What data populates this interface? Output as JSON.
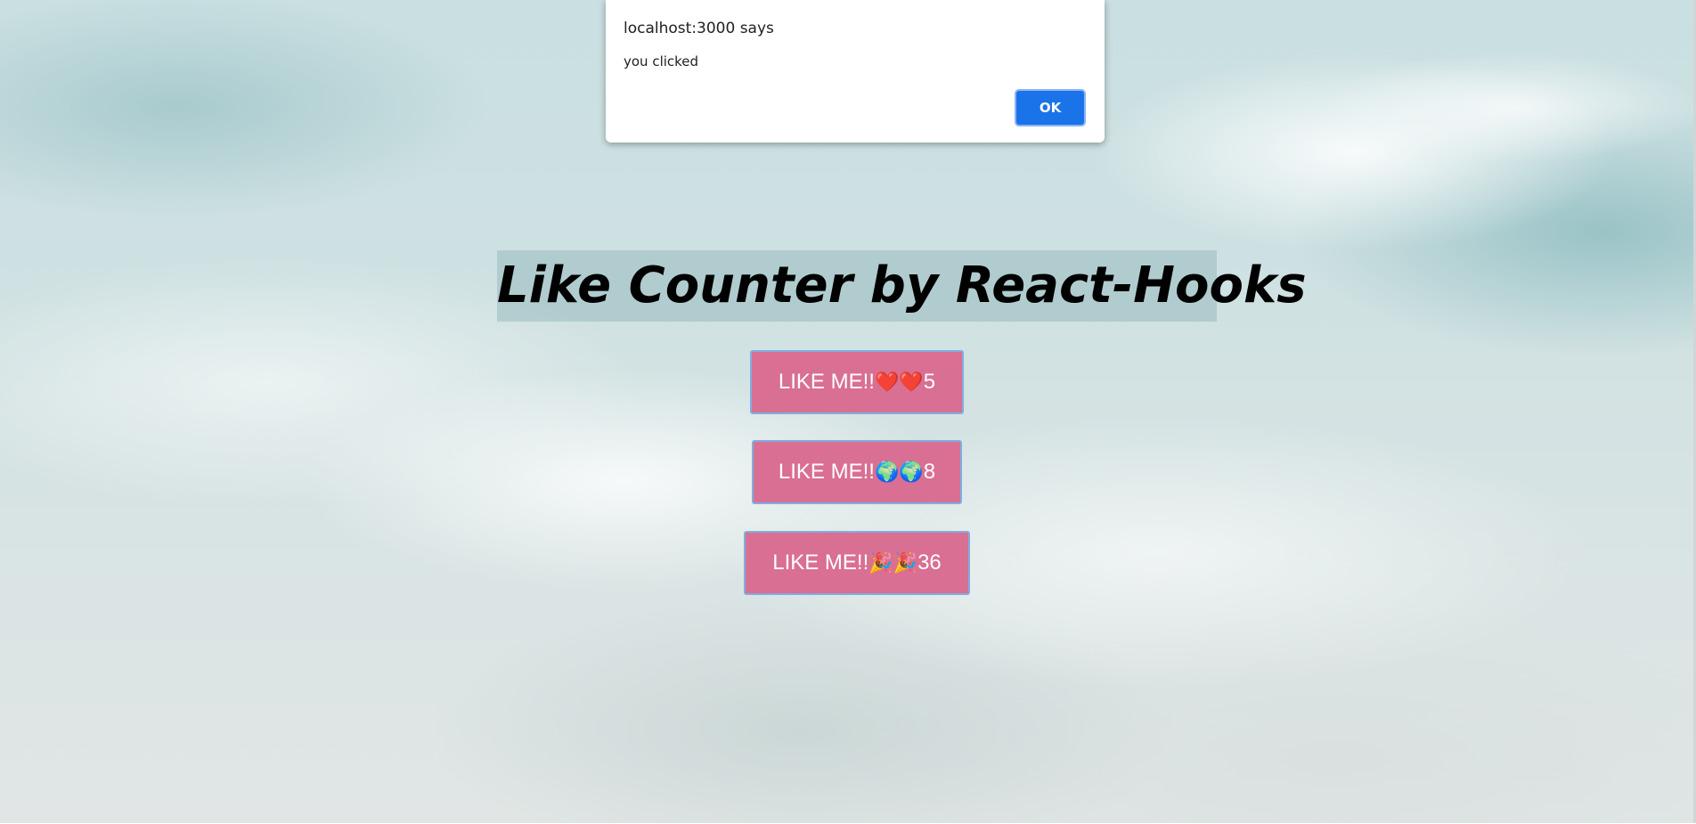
{
  "page": {
    "title": "Like Counter by React-Hooks"
  },
  "buttons": [
    {
      "label": "LIKE ME!!",
      "emoji": "❤️❤️",
      "emoji_name": "heart-icon",
      "count": "5"
    },
    {
      "label": "LIKE ME!!",
      "emoji": "🌍🌍",
      "emoji_name": "globe-icon",
      "count": "8"
    },
    {
      "label": "LIKE ME!!",
      "emoji": "🎉🎉",
      "emoji_name": "party-popper-icon",
      "count": "36"
    }
  ],
  "alert": {
    "origin": "localhost:3000 says",
    "message": "you clicked",
    "ok_label": "OK"
  },
  "colors": {
    "button_bg": "#d96f92",
    "button_border": "#7faee0",
    "ok_button_bg": "#1a73e8"
  }
}
